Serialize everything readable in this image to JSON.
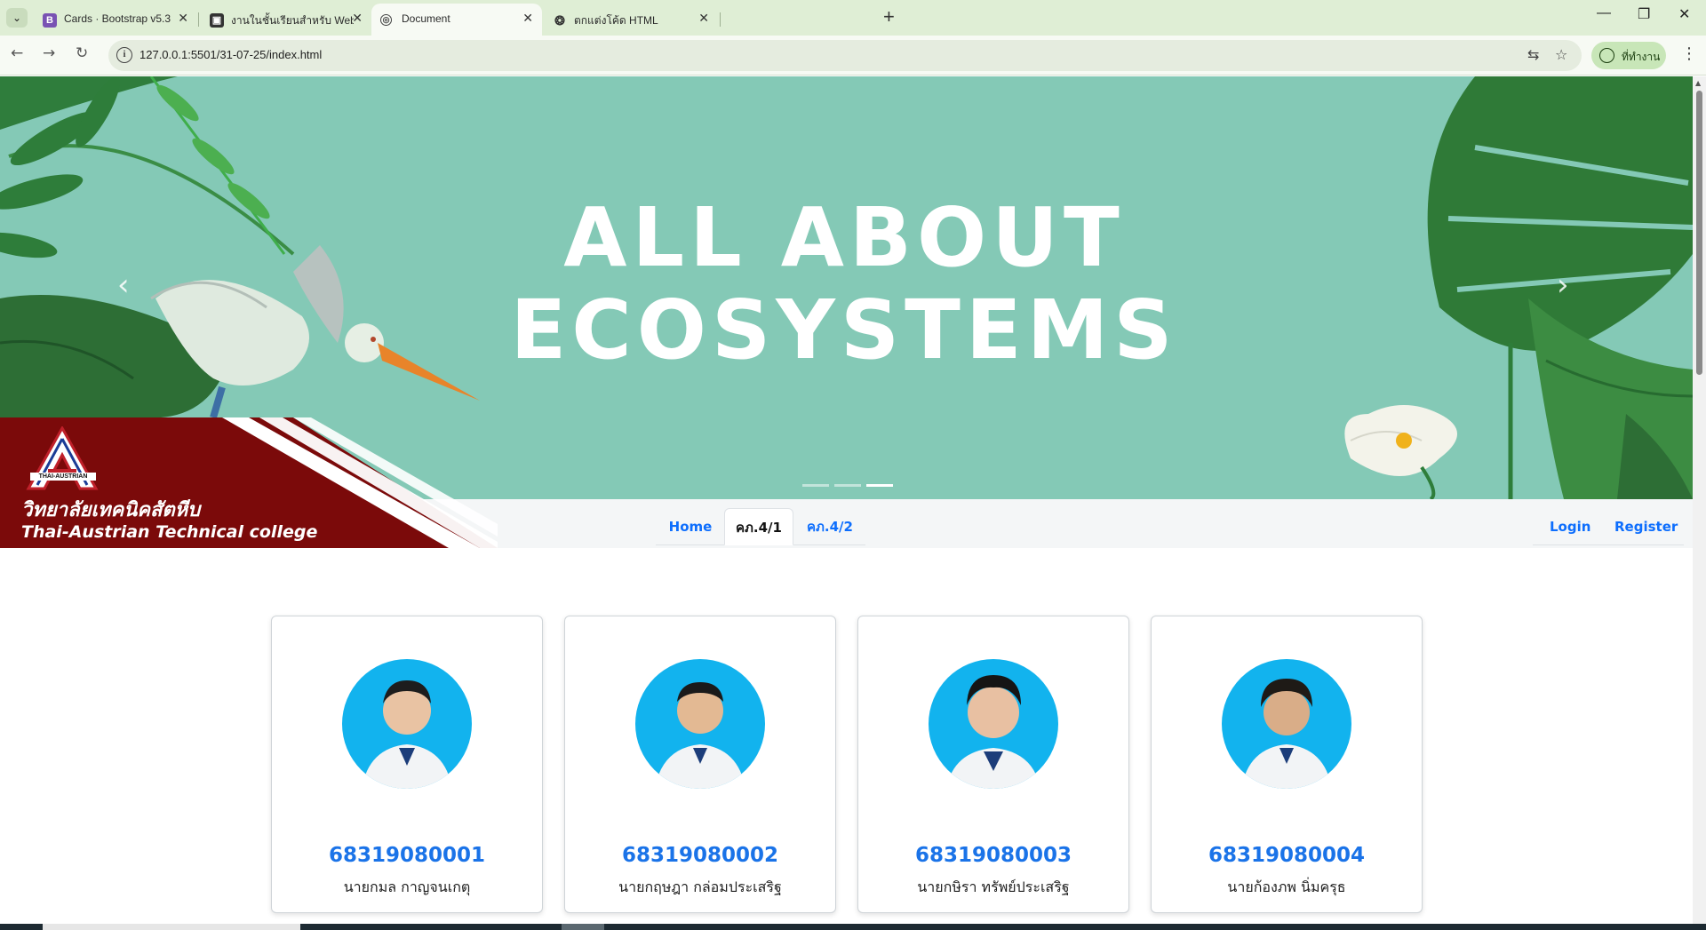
{
  "browser": {
    "tabs": [
      {
        "title": "Cards · Bootstrap v5.3",
        "favicon": "bootstrap-icon",
        "active": false
      },
      {
        "title": "งานในชั้นเรียนสำหรับ Web Design",
        "favicon": "classroom-icon",
        "active": false
      },
      {
        "title": "Document",
        "favicon": "globe-icon",
        "active": true
      },
      {
        "title": "ตกแต่งโค้ด HTML",
        "favicon": "chatgpt-icon",
        "active": false
      }
    ],
    "url": "127.0.0.1:5501/31-07-25/index.html",
    "profile_label": "ที่ทำงาน"
  },
  "hero": {
    "title_line1": "ALL ABOUT",
    "title_line2": "ECOSYSTEMS",
    "prev_label": "‹",
    "next_label": "›",
    "slide_count": 3,
    "active_slide": 3
  },
  "college": {
    "logo_text": "THAI-AUSTRIAN",
    "name_th": "วิทยาลัยเทคนิคสัตหีบ",
    "name_en": "Thai-Austrian Technical college"
  },
  "nav": {
    "tabs": [
      {
        "label": "Home",
        "active": false
      },
      {
        "label": "คภ.4/1",
        "active": true
      },
      {
        "label": "คภ.4/2",
        "active": false
      }
    ],
    "login": "Login",
    "register": "Register"
  },
  "cards": [
    {
      "id": "68319080001",
      "name": "นายกมล กาญจนเกตุ"
    },
    {
      "id": "68319080002",
      "name": "นายกฤษฎา กล่อมประเสริฐ"
    },
    {
      "id": "68319080003",
      "name": "นายกษิรา ทรัพย์ประเสริฐ"
    },
    {
      "id": "68319080004",
      "name": "นายก้องภพ นิ่มครุธ"
    }
  ],
  "colors": {
    "hero_bg": "#84c9b6",
    "college_red": "#7b0a0a",
    "link_blue": "#0d6efd",
    "card_id_blue": "#1a73e8",
    "avatar_bg": "#12b3ee"
  }
}
